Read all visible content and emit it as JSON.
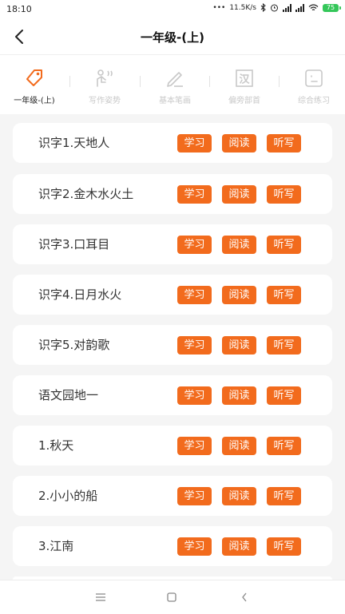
{
  "status": {
    "time": "18:10",
    "network_speed": "11.5K/s",
    "battery": "75"
  },
  "header": {
    "title": "一年级-(上)",
    "back_icon": "back-arrow-icon"
  },
  "tabs": [
    {
      "label": "一年级-(上)",
      "icon": "tag-icon",
      "active": true
    },
    {
      "label": "写作姿势",
      "icon": "writing-posture-icon",
      "active": false
    },
    {
      "label": "基本笔画",
      "icon": "pencil-icon",
      "active": false
    },
    {
      "label": "偏旁部首",
      "icon": "han-character-icon",
      "active": false
    },
    {
      "label": "综合练习",
      "icon": "practice-box-icon",
      "active": false
    }
  ],
  "lessons": [
    {
      "title": "识字1.天地人",
      "buttons": [
        "学习",
        "阅读",
        "听写"
      ]
    },
    {
      "title": "识字2.金木水火土",
      "buttons": [
        "学习",
        "阅读",
        "听写"
      ]
    },
    {
      "title": "识字3.口耳目",
      "buttons": [
        "学习",
        "阅读",
        "听写"
      ]
    },
    {
      "title": "识字4.日月水火",
      "buttons": [
        "学习",
        "阅读",
        "听写"
      ]
    },
    {
      "title": "识字5.对韵歌",
      "buttons": [
        "学习",
        "阅读",
        "听写"
      ]
    },
    {
      "title": "语文园地一",
      "buttons": [
        "学习",
        "阅读",
        "听写"
      ]
    },
    {
      "title": "1.秋天",
      "buttons": [
        "学习",
        "阅读",
        "听写"
      ]
    },
    {
      "title": "2.小小的船",
      "buttons": [
        "学习",
        "阅读",
        "听写"
      ]
    },
    {
      "title": "3.江南",
      "buttons": [
        "学习",
        "阅读",
        "听写"
      ]
    }
  ],
  "colors": {
    "accent": "#f26b1d",
    "background": "#f5f5f5",
    "inactive_tab": "#c8c8c8"
  },
  "system_nav": [
    "menu-icon",
    "home-icon",
    "back-icon"
  ]
}
